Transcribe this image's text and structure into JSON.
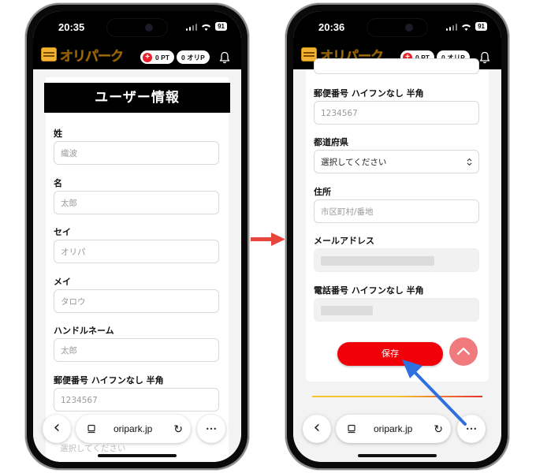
{
  "left_phone": {
    "time": "20:35",
    "battery": "91",
    "app_logo": "オリパーク",
    "points_pill": "0 PT",
    "oripa_pill": "0 オリP",
    "page_title": "ユーザー情報",
    "fields": [
      {
        "label": "姓",
        "placeholder": "織波"
      },
      {
        "label": "名",
        "placeholder": "太郎"
      },
      {
        "label": "セイ",
        "placeholder": "オリパ"
      },
      {
        "label": "メイ",
        "placeholder": "タロウ"
      },
      {
        "label": "ハンドルネーム",
        "placeholder": "太郎"
      },
      {
        "label": "郵便番号 ハイフンなし 半角",
        "placeholder": "1234567"
      }
    ],
    "cutoff_select": "選択してください",
    "url": "oripark.jp"
  },
  "right_phone": {
    "time": "20:36",
    "battery": "91",
    "app_logo": "オリパーク",
    "points_pill": "0 PT",
    "oripa_pill": "0 オリP",
    "fields": [
      {
        "label": "郵便番号 ハイフンなし 半角",
        "placeholder": "1234567"
      },
      {
        "label": "都道府県",
        "value": "選択してください"
      },
      {
        "label": "住所",
        "placeholder": "市区町村/番地"
      },
      {
        "label": "メールアドレス"
      },
      {
        "label": "電話番号 ハイフンなし 半角"
      }
    ],
    "save_button": "保存",
    "url": "oripark.jp"
  },
  "icons": {
    "plus": "+",
    "back": "‹",
    "more": "•••",
    "reload": "↻",
    "select_chevron": "⌃⌄"
  },
  "colors": {
    "accent_red": "#f2000a",
    "logo_yellow": "#f6c431",
    "arrow_blue": "#2f6fe0",
    "arrow_red": "#e8463c"
  }
}
